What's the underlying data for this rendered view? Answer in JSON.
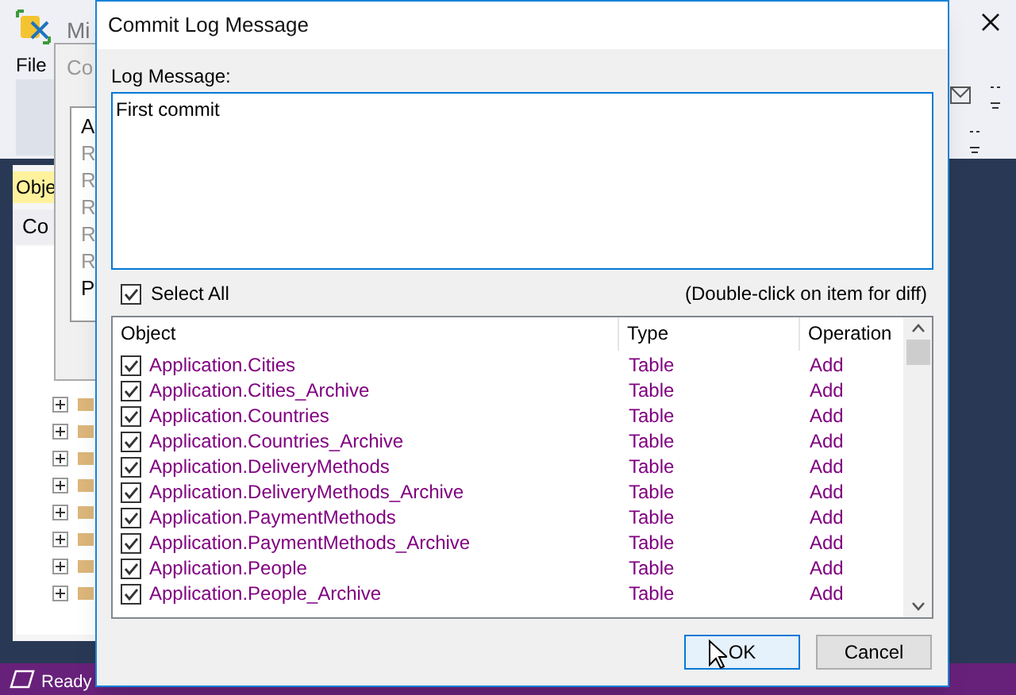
{
  "background_app": {
    "title": "Mi",
    "menu": [
      "File"
    ],
    "panel_tab": "Obje",
    "panel_header": "Co",
    "status_bar": "Ready"
  },
  "background_dialog": {
    "title": "Co",
    "items": [
      "A",
      "R",
      "R",
      "R",
      "R",
      "R",
      "P"
    ]
  },
  "dialog": {
    "title": "Commit Log Message",
    "log_label": "Log Message:",
    "message": "First commit",
    "select_all": {
      "label": "Select All",
      "checked": true
    },
    "hint": "(Double-click on item for diff)",
    "columns": [
      "Object",
      "Type",
      "Operation"
    ],
    "rows": [
      {
        "object": "Application.Cities",
        "type": "Table",
        "operation": "Add",
        "checked": true
      },
      {
        "object": "Application.Cities_Archive",
        "type": "Table",
        "operation": "Add",
        "checked": true
      },
      {
        "object": "Application.Countries",
        "type": "Table",
        "operation": "Add",
        "checked": true
      },
      {
        "object": "Application.Countries_Archive",
        "type": "Table",
        "operation": "Add",
        "checked": true
      },
      {
        "object": "Application.DeliveryMethods",
        "type": "Table",
        "operation": "Add",
        "checked": true
      },
      {
        "object": "Application.DeliveryMethods_Archive",
        "type": "Table",
        "operation": "Add",
        "checked": true
      },
      {
        "object": "Application.PaymentMethods",
        "type": "Table",
        "operation": "Add",
        "checked": true
      },
      {
        "object": "Application.PaymentMethods_Archive",
        "type": "Table",
        "operation": "Add",
        "checked": true
      },
      {
        "object": "Application.People",
        "type": "Table",
        "operation": "Add",
        "checked": true
      },
      {
        "object": "Application.People_Archive",
        "type": "Table",
        "operation": "Add",
        "checked": true
      }
    ],
    "buttons": [
      {
        "label": "OK",
        "default": true
      },
      {
        "label": "Cancel",
        "default": false
      }
    ]
  }
}
